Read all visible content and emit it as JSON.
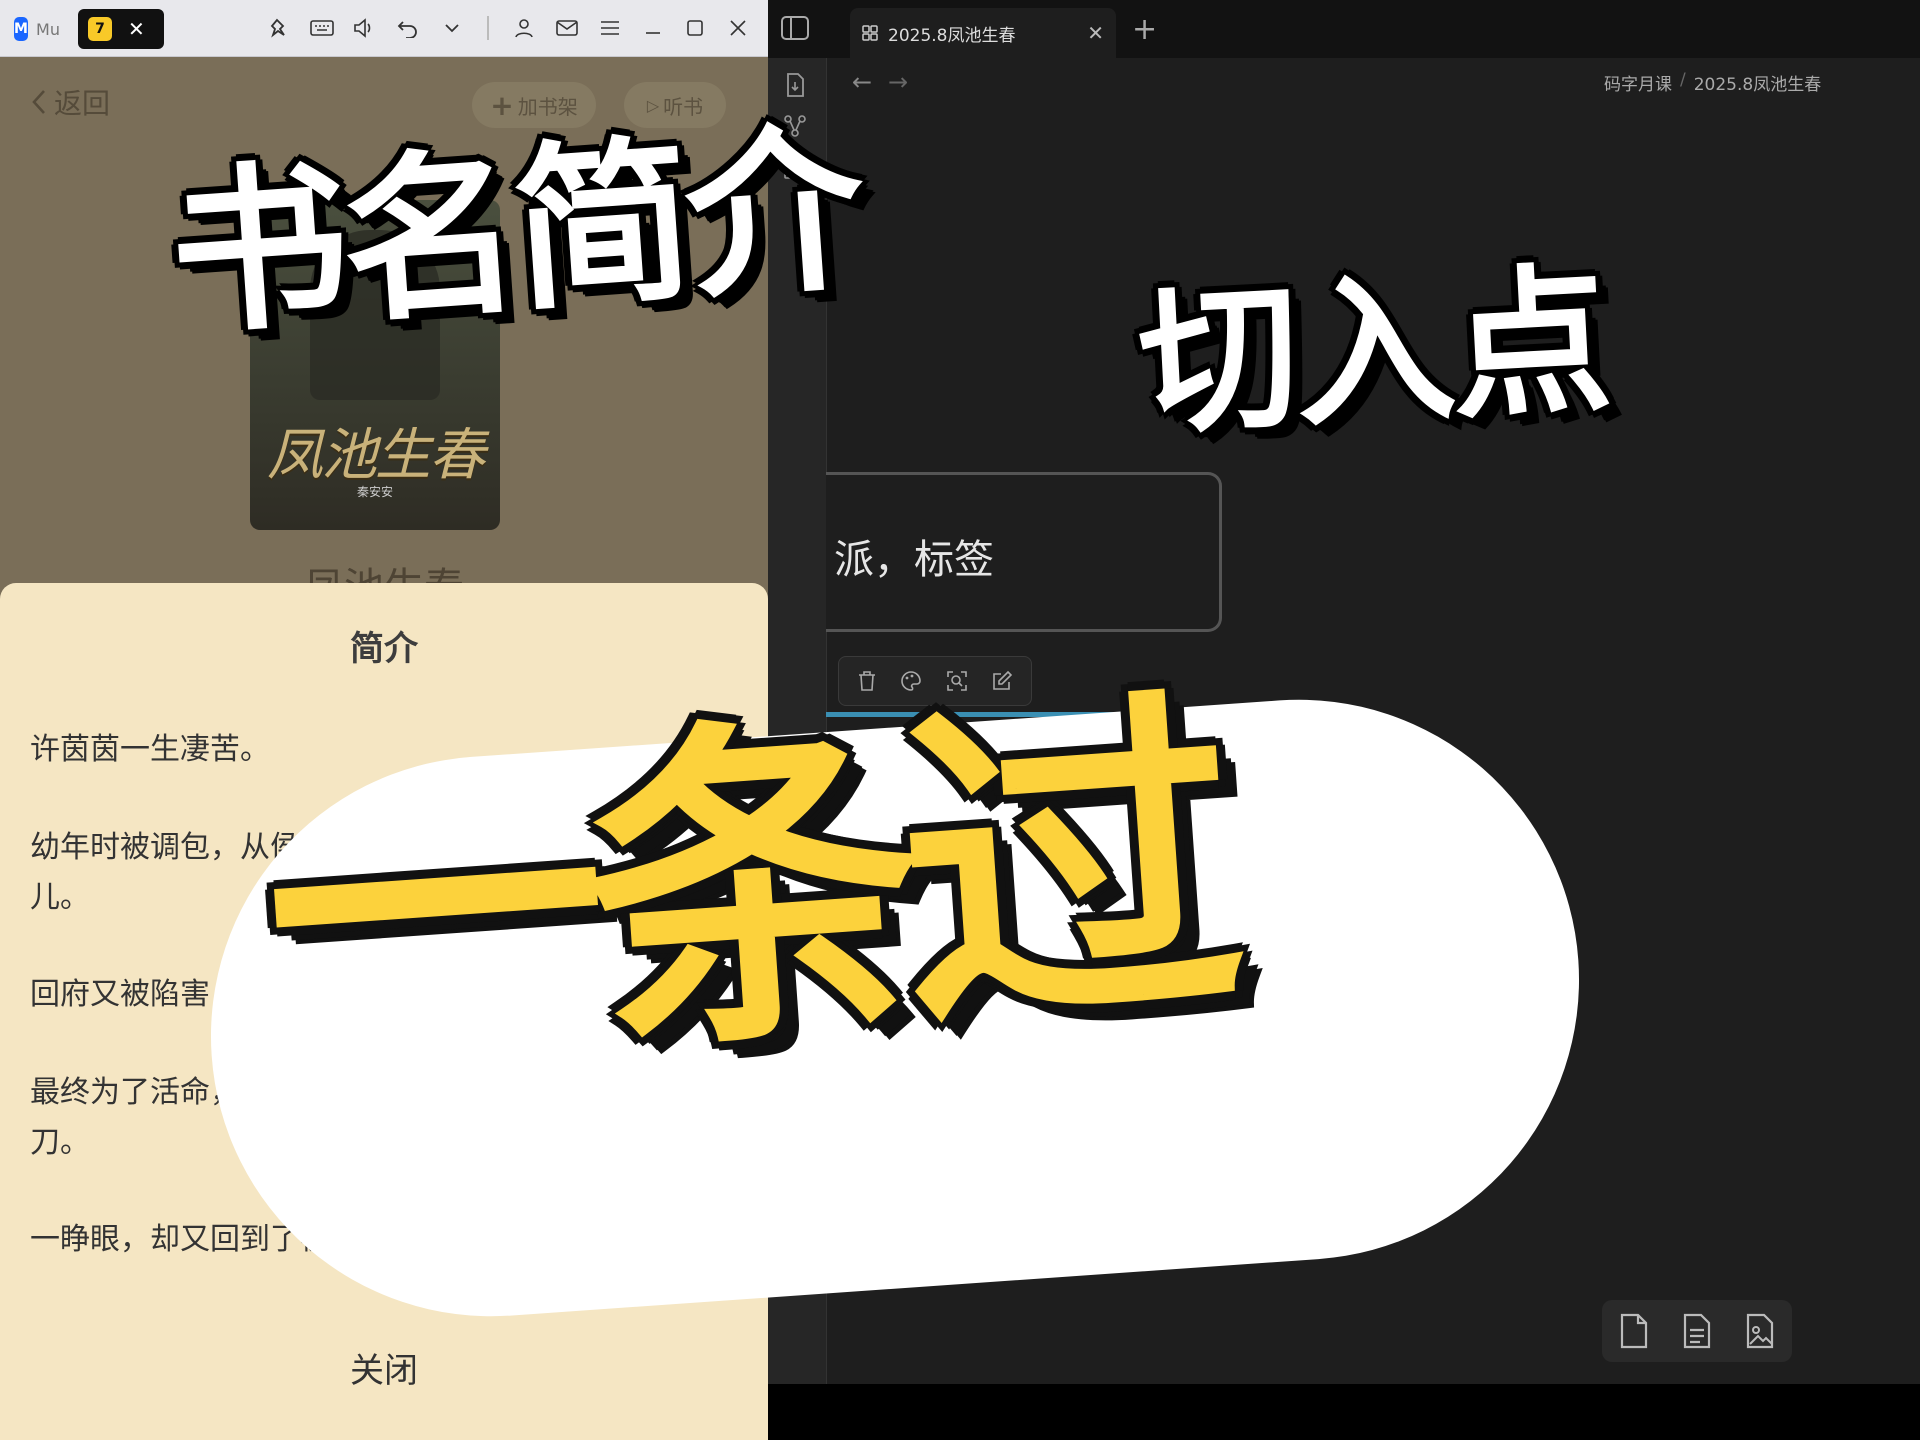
{
  "left_window": {
    "tabs": [
      {
        "label": "Mu",
        "icon": "mubu-logo-icon"
      },
      {
        "label": "",
        "icon": "reader-app-icon",
        "close": "✕"
      }
    ],
    "titlebar_icons": [
      "pin-icon",
      "keyboard-icon",
      "volume-icon",
      "undo-icon",
      "chevron-down-icon",
      "user-icon",
      "mail-icon",
      "menu-icon",
      "minimize-icon",
      "maximize-icon",
      "close-icon"
    ]
  },
  "reader": {
    "back_label": "返回",
    "add_shelf_label": "加书架",
    "listen_label": "听书",
    "cover_art_title": "凤池生春",
    "cover_author": "秦安安",
    "book_title": "凤池生春",
    "sheet": {
      "title": "简介",
      "paragraphs": [
        "许茵茵一生凄苦。",
        "幼年时被调包，从侯府千金沦落成杀猪匠的女儿。",
        "回府又被陷害",
        "最终为了活命，",
        "一睁眼，却又回到了被接回侯府的前夜。"
      ],
      "para2_line1": "幼年时被调包，从侯府千金沦落成杀猪匠的",
      "para2_line2": "儿。",
      "para4_line1": "最终为了活命，",
      "para4_line2": "刀。",
      "close_label": "关闭"
    }
  },
  "editor": {
    "tab_label": "2025.8凤池生春",
    "tab_close": "✕",
    "new_tab": "+",
    "breadcrumb": [
      "码字月课",
      "2025.8凤池生春"
    ],
    "breadcrumb_sep": "/",
    "card_text": "派，标签",
    "card_toolbar": [
      "trash-icon",
      "palette-icon",
      "zoom-to-fit-icon",
      "edit-icon"
    ],
    "bottom_tools": [
      "new-card-icon",
      "new-note-icon",
      "add-media-icon"
    ],
    "nav_back": "←",
    "nav_forward": "→"
  },
  "captions": {
    "title": "书名简介",
    "entry": "切入点",
    "pass": "一条过",
    "pass_color": "#fcd23c"
  }
}
